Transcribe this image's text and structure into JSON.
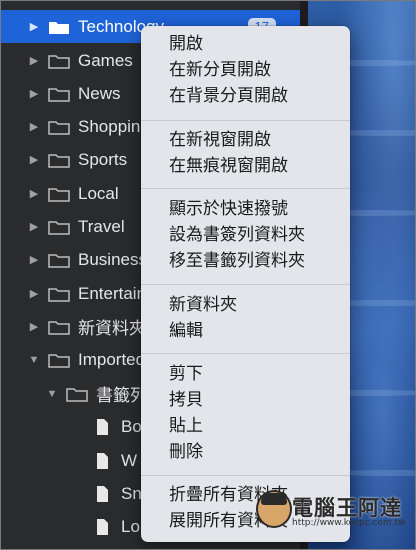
{
  "sidebar": {
    "items": [
      {
        "label": "Technology",
        "badge": "17",
        "type": "folder",
        "disclosure": "right",
        "selected": true
      },
      {
        "label": "Games",
        "type": "folder",
        "disclosure": "right"
      },
      {
        "label": "News",
        "type": "folder",
        "disclosure": "right"
      },
      {
        "label": "Shopping",
        "type": "folder",
        "disclosure": "right"
      },
      {
        "label": "Sports",
        "type": "folder",
        "disclosure": "right"
      },
      {
        "label": "Local",
        "type": "folder",
        "disclosure": "right"
      },
      {
        "label": "Travel",
        "type": "folder",
        "disclosure": "right"
      },
      {
        "label": "Business",
        "type": "folder",
        "disclosure": "right"
      },
      {
        "label": "Entertainment",
        "type": "folder",
        "disclosure": "right"
      },
      {
        "label": "新資料夾",
        "type": "folder",
        "disclosure": "right"
      },
      {
        "label": "Imported",
        "type": "folder",
        "disclosure": "down"
      },
      {
        "label": "書籤列",
        "type": "folder",
        "disclosure": "down"
      },
      {
        "label": "Bo",
        "type": "page"
      },
      {
        "label": "W",
        "type": "page"
      },
      {
        "label": "Sn",
        "type": "page"
      },
      {
        "label": "Lo",
        "type": "page"
      }
    ]
  },
  "context_menu": {
    "groups": [
      [
        "開啟",
        "在新分頁開啟",
        "在背景分頁開啟"
      ],
      [
        "在新視窗開啟",
        "在無痕視窗開啟"
      ],
      [
        "顯示於快速撥號",
        "設為書簽列資料夾",
        "移至書籤列資料夾"
      ],
      [
        "新資料夾",
        "編輯"
      ],
      [
        "剪下",
        "拷貝",
        "貼上",
        "刪除"
      ],
      [
        "折疊所有資料夾",
        "展開所有資料夾"
      ]
    ]
  },
  "watermark": {
    "text": "電腦王阿達",
    "url": "http://www.kocpc.com.tw"
  },
  "colors": {
    "selection": "#1f63d8",
    "menu_bg": "#e3e5ea",
    "sidebar_bg": "#2a2b2d"
  }
}
